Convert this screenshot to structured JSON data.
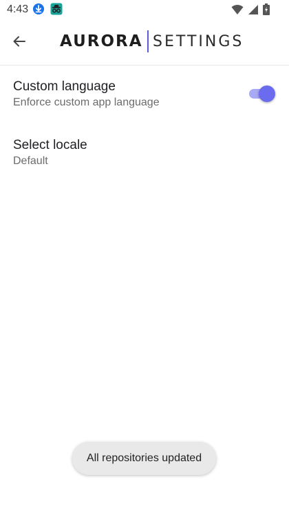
{
  "status_bar": {
    "time": "4:43",
    "icons": [
      "download-icon",
      "incognito-app-icon",
      "wifi-icon",
      "signal-icon",
      "battery-icon"
    ]
  },
  "app_bar": {
    "back_icon": "arrow-back-icon",
    "logo_primary": "AURORA",
    "logo_secondary": "SETTINGS"
  },
  "preferences": [
    {
      "title": "Custom language",
      "summary": "Enforce custom app language",
      "toggle_on": true
    },
    {
      "title": "Select locale",
      "summary": "Default"
    }
  ],
  "toast": {
    "message": "All repositories updated"
  },
  "colors": {
    "accent": "#6b6bf0",
    "accent_track": "#a9a9f5",
    "logo_bar": "#5b5bd6",
    "toast_bg": "#e9e9e9"
  }
}
